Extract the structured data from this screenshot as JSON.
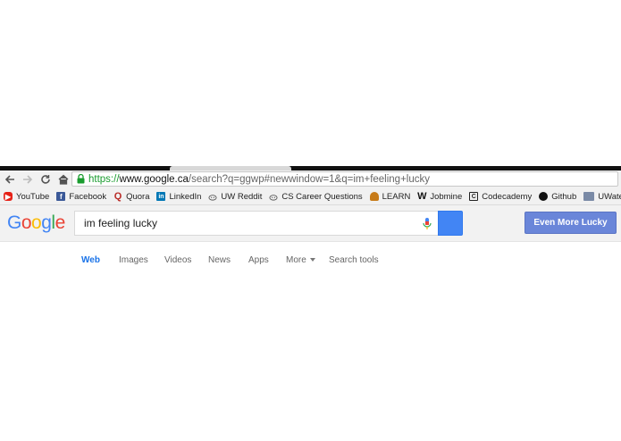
{
  "browser": {
    "url": {
      "scheme": "https://",
      "host": "www.google.ca",
      "rest": "/search?q=ggwp#newwindow=1&q=im+feeling+lucky"
    },
    "bookmarks": [
      {
        "label": "YouTube",
        "icon": "youtube-icon",
        "color": "#e62117"
      },
      {
        "label": "Facebook",
        "icon": "facebook-icon",
        "color": "#3b5998"
      },
      {
        "label": "Quora",
        "icon": "quora-icon",
        "color": "#b92b27"
      },
      {
        "label": "LinkedIn",
        "icon": "linkedin-icon",
        "color": "#0077b5"
      },
      {
        "label": "UW Reddit",
        "icon": "reddit-icon",
        "color": "#555555"
      },
      {
        "label": "CS Career Questions",
        "icon": "reddit-icon",
        "color": "#555555"
      },
      {
        "label": "LEARN",
        "icon": "learn-icon",
        "color": "#c77b19"
      },
      {
        "label": "Jobmine",
        "icon": "jobmine-icon",
        "color": "#111111"
      },
      {
        "label": "Codecademy",
        "icon": "codecademy-icon",
        "color": "#222222"
      },
      {
        "label": "Github",
        "icon": "github-icon",
        "color": "#111111"
      },
      {
        "label": "UWaterloo",
        "icon": "folder-icon",
        "color": "#7a8aa6"
      }
    ]
  },
  "google": {
    "logo_letters": [
      {
        "ch": "G",
        "color": "#4285f4"
      },
      {
        "ch": "o",
        "color": "#ea4335"
      },
      {
        "ch": "o",
        "color": "#fbbc05"
      },
      {
        "ch": "g",
        "color": "#4285f4"
      },
      {
        "ch": "l",
        "color": "#34a853"
      },
      {
        "ch": "e",
        "color": "#ea4335"
      }
    ],
    "search_query": "im feeling lucky",
    "lucky_button": "Even More Lucky",
    "tabs": [
      {
        "label": "Web",
        "active": true
      },
      {
        "label": "Images",
        "active": false
      },
      {
        "label": "Videos",
        "active": false
      },
      {
        "label": "News",
        "active": false
      },
      {
        "label": "Apps",
        "active": false
      },
      {
        "label": "More",
        "active": false
      },
      {
        "label": "Search tools",
        "active": false
      }
    ]
  }
}
